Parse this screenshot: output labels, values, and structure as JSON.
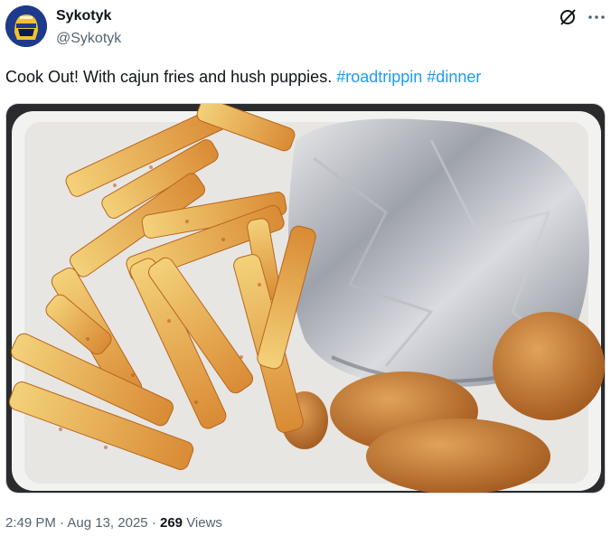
{
  "author": {
    "name": "Sykotyk",
    "handle": "@Sykotyk",
    "avatar_icon": "helmet-avatar-icon"
  },
  "header_actions": {
    "grok_icon": "grok-icon",
    "more_icon": "more-options-icon"
  },
  "tweet": {
    "text": "Cook Out! With cajun fries and hush puppies.",
    "hashtags": [
      "#roadtrippin",
      "#dinner"
    ]
  },
  "media": {
    "description_icon": "food-photo"
  },
  "meta": {
    "time": "2:49 PM",
    "separator": "·",
    "date": "Aug 13, 2025",
    "views_count": "269",
    "views_label": "Views"
  },
  "colors": {
    "accent": "#1d9bf0",
    "text": "#0f1419",
    "muted": "#536471"
  }
}
